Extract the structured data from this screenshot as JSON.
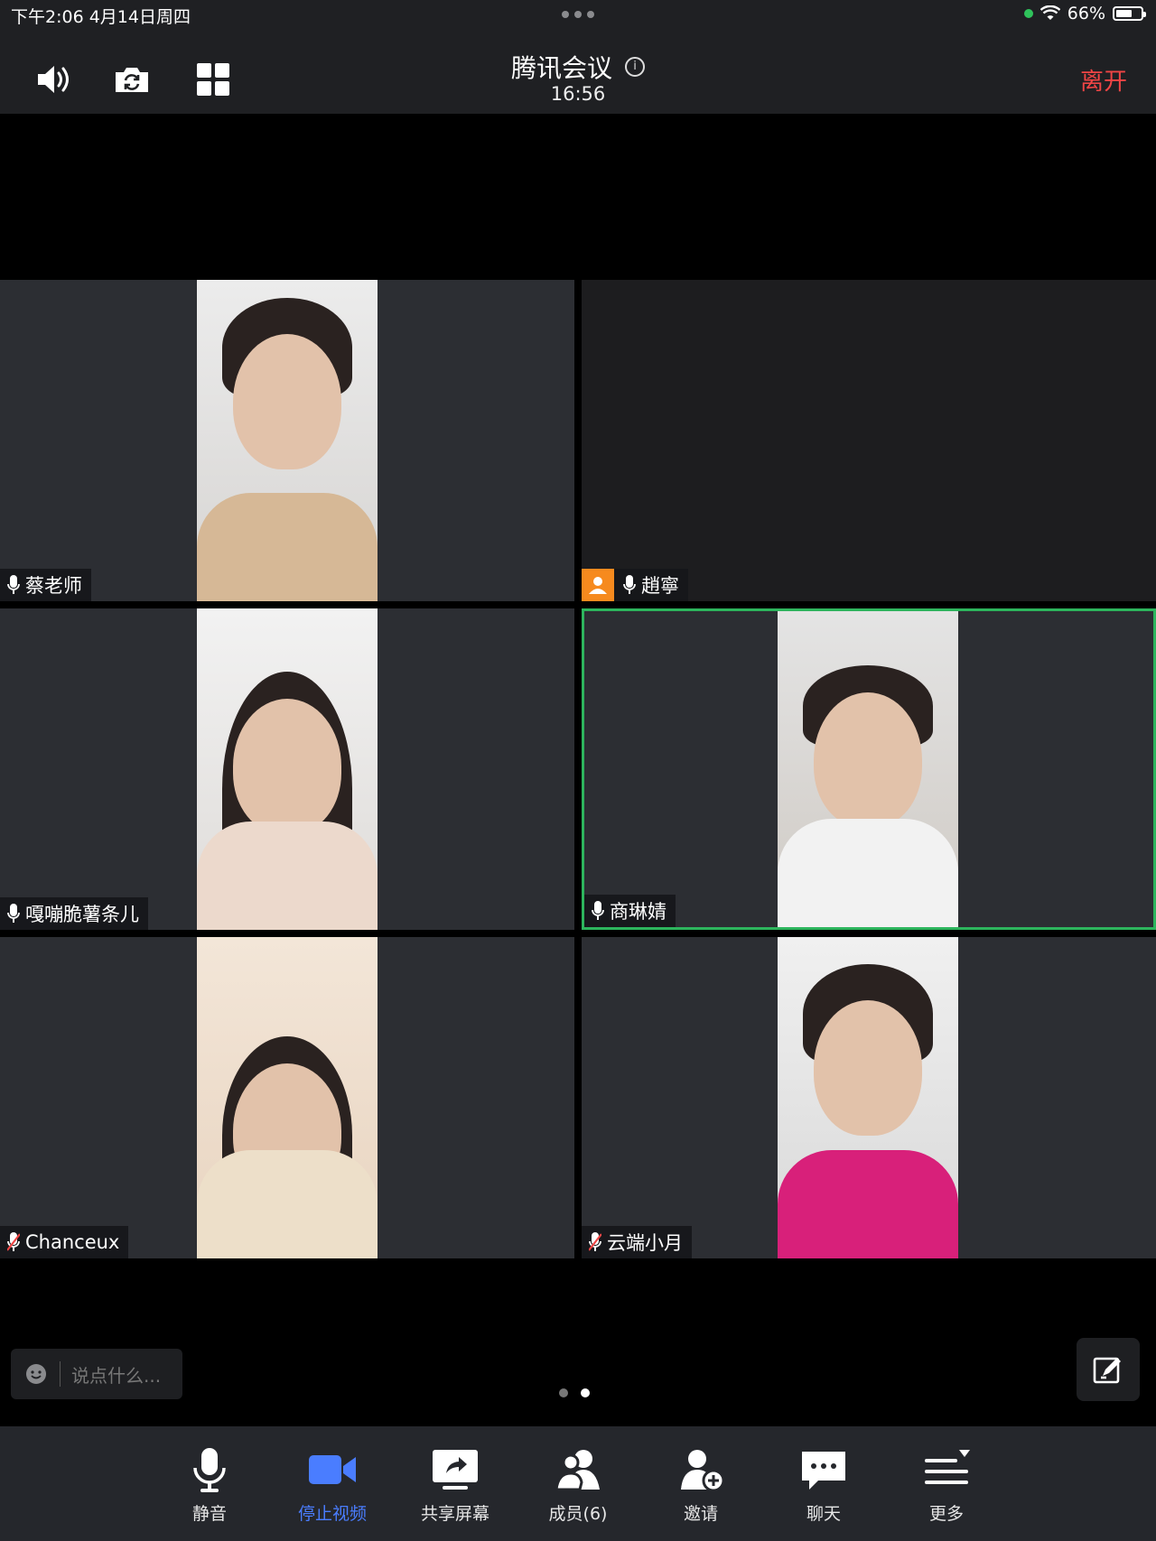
{
  "status_bar": {
    "time_date": "下午2:06   4月14日周四",
    "battery": "66%",
    "battery_level": 0.66
  },
  "header": {
    "title": "腾讯会议",
    "duration": "16:56",
    "leave_label": "离开",
    "info_glyph": "i"
  },
  "participants": [
    {
      "name": "蔡老师",
      "mic": "on"
    },
    {
      "name": "趙寧",
      "mic": "on"
    },
    {
      "name": "嘎嘣脆薯条儿",
      "mic": "on"
    },
    {
      "name": "商琳婧",
      "mic": "on"
    },
    {
      "name": "Chanceux",
      "mic": "muted"
    },
    {
      "name": "云端小月",
      "mic": "muted"
    }
  ],
  "chat": {
    "placeholder": "说点什么..."
  },
  "toolbar": {
    "mute": "静音",
    "stop_video": "停止视频",
    "share_screen": "共享屏幕",
    "members": "成员(6)",
    "invite": "邀请",
    "chat": "聊天",
    "more": "更多"
  },
  "colors": {
    "leave": "#f04545",
    "active_border": "#2db55d",
    "accent": "#4a7dff",
    "badge": "#f68a1e"
  }
}
